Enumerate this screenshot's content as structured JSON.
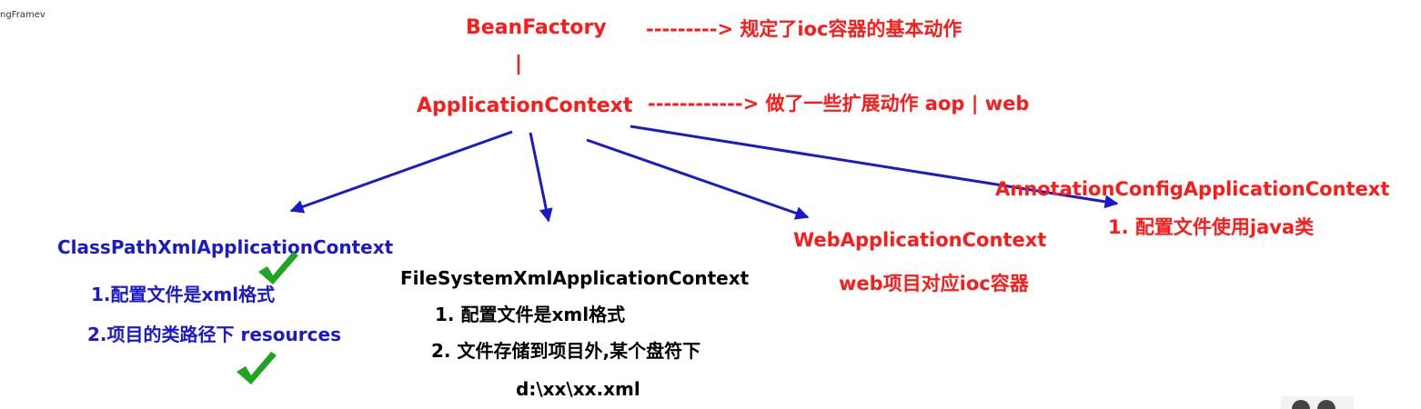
{
  "edge_fragment": "ngFramev",
  "bean_factory": {
    "name": "BeanFactory",
    "desc": "---------> 规定了ioc容器的基本动作",
    "separator": "|"
  },
  "application_context": {
    "name": "ApplicationContext",
    "desc": "------------> 做了一些扩展动作 aop  | web"
  },
  "classpath": {
    "name": "ClassPathXmlApplicationContext",
    "line1": "1.配置文件是xml格式",
    "line2": "2.项目的类路径下 resources"
  },
  "filesystem": {
    "name": "FileSystemXmlApplicationContext",
    "line1": "1. 配置文件是xml格式",
    "line2": "2. 文件存储到项目外,某个盘符下",
    "line3": "d:\\xx\\xx.xml"
  },
  "web": {
    "name": "WebApplicationContext",
    "line1": "web项目对应ioc容器"
  },
  "annotation": {
    "name": "AnnotationConfigApplicationContext",
    "line1": "1. 配置文件使用java类"
  },
  "colors": {
    "heading": "#ff1a1a",
    "classpath": "#1a1acc",
    "body": "#000000",
    "arrow": "#1a1acc",
    "check": "#1fa51f"
  }
}
